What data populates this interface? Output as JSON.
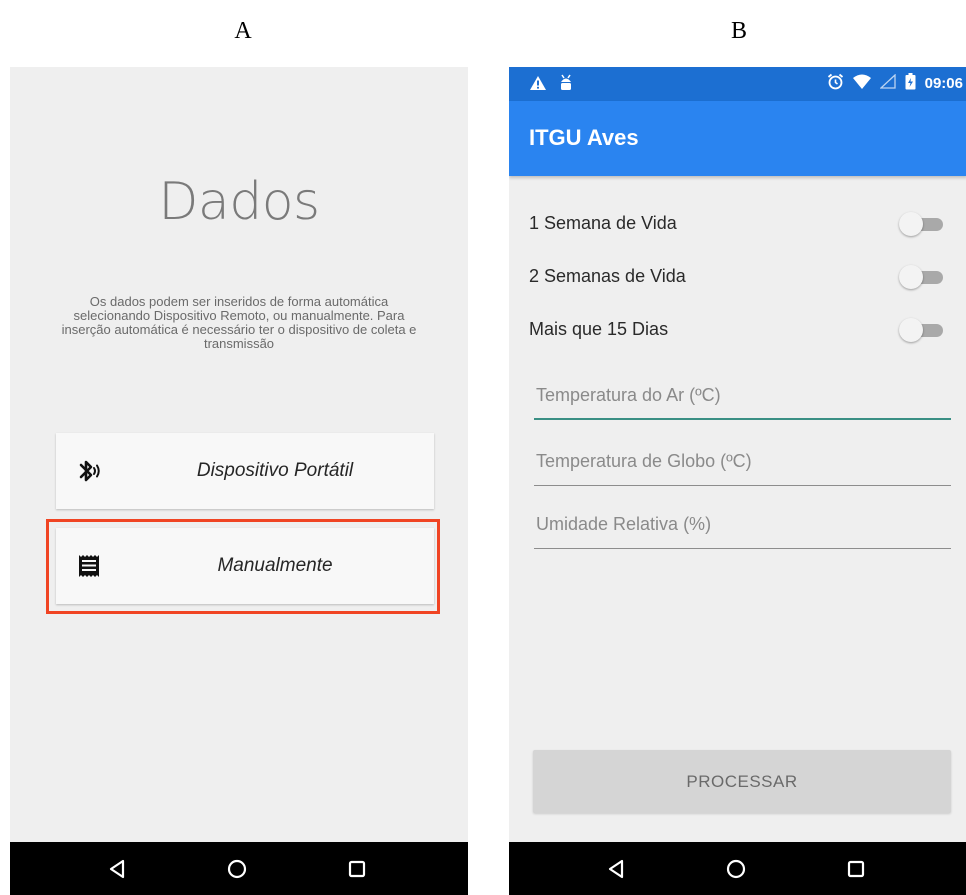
{
  "labels": {
    "a": "A",
    "b": "B"
  },
  "screen_a": {
    "title": "Dados",
    "description": "Os dados podem ser inseridos de forma automática selecionando Dispositivo Remoto, ou manualmente. Para inserção automática é necessário ter o dispositivo de coleta e transmissão",
    "options": [
      {
        "label": "Dispositivo Portátil",
        "icon": "bluetooth-audio-icon"
      },
      {
        "label": "Manualmente",
        "icon": "receipt-icon"
      }
    ],
    "highlight_color": "#f04423"
  },
  "screen_b": {
    "status_bar": {
      "time": "09:06",
      "left_icons": [
        "warning-icon",
        "android-debug-icon"
      ],
      "right_icons": [
        "alarm-icon",
        "wifi-icon",
        "signal-icon",
        "battery-icon"
      ]
    },
    "app_title": "ITGU Aves",
    "toggles": [
      {
        "label": "1 Semana de Vida",
        "checked": false
      },
      {
        "label": "2 Semanas de Vida",
        "checked": false
      },
      {
        "label": "Mais que 15 Dias",
        "checked": false
      }
    ],
    "fields": [
      {
        "placeholder": "Temperatura do Ar (ºC)",
        "value": "",
        "focused": true
      },
      {
        "placeholder": "Temperatura de Globo (ºC)",
        "value": ""
      },
      {
        "placeholder": "Umidade Relativa (%)",
        "value": ""
      }
    ],
    "process_button": "PROCESSAR",
    "colors": {
      "status_bar": "#1c6fd2",
      "app_bar": "#2a84f0",
      "focus_accent": "#3a8f84"
    }
  },
  "nav_bar": {
    "buttons": [
      "back-icon",
      "home-icon",
      "recents-icon"
    ]
  }
}
